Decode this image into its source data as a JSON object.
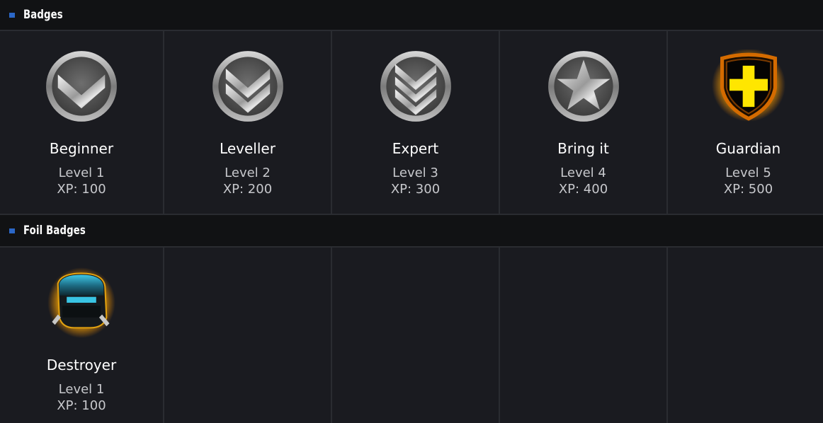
{
  "sections": [
    {
      "title": "Badges",
      "badges": [
        {
          "name": "Beginner",
          "level": "Level 1",
          "xp": "XP: 100",
          "icon": "single-chevron-badge-icon"
        },
        {
          "name": "Leveller",
          "level": "Level 2",
          "xp": "XP: 200",
          "icon": "double-chevron-badge-icon"
        },
        {
          "name": "Expert",
          "level": "Level 3",
          "xp": "XP: 300",
          "icon": "triple-chevron-badge-icon"
        },
        {
          "name": "Bring it",
          "level": "Level 4",
          "xp": "XP: 400",
          "icon": "star-badge-icon"
        },
        {
          "name": "Guardian",
          "level": "Level 5",
          "xp": "XP: 500",
          "icon": "cross-shield-badge-icon"
        }
      ]
    },
    {
      "title": "Foil Badges",
      "badges": [
        {
          "name": "Destroyer",
          "level": "Level 1",
          "xp": "XP: 100",
          "icon": "helmet-badge-icon"
        }
      ]
    }
  ],
  "colors": {
    "accent": "#2b67c7",
    "background": "#1a1b20",
    "header_background": "#111214",
    "gold": "#f0b400",
    "guardian_yellow": "#ffe600"
  }
}
